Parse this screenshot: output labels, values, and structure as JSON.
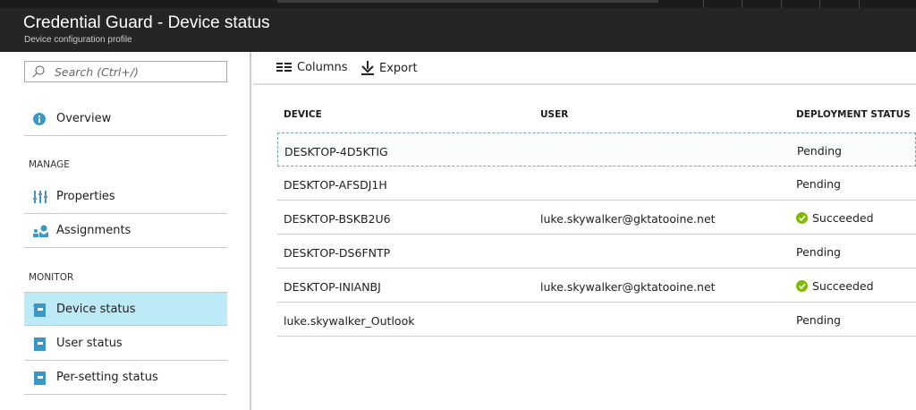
{
  "header": {
    "title": "Credential Guard - Device status",
    "subtitle": "Device configuration profile"
  },
  "sidebar": {
    "search_placeholder": "Search (Ctrl+/)",
    "overview": "Overview",
    "manage_heading": "MANAGE",
    "manage": [
      {
        "label": "Properties",
        "icon": "properties-icon"
      },
      {
        "label": "Assignments",
        "icon": "assignments-icon"
      }
    ],
    "monitor_heading": "MONITOR",
    "monitor": [
      {
        "label": "Device status",
        "selected": true
      },
      {
        "label": "User status"
      },
      {
        "label": "Per-setting status"
      }
    ]
  },
  "toolbar": {
    "columns": "Columns",
    "export": "Export"
  },
  "table": {
    "headers": [
      "DEVICE",
      "USER",
      "DEPLOYMENT STATUS"
    ],
    "rows": [
      {
        "device": "DESKTOP-4D5KTIG",
        "user": "",
        "status": "Pending"
      },
      {
        "device": "DESKTOP-AFSDJ1H",
        "user": "",
        "status": "Pending"
      },
      {
        "device": "DESKTOP-BSKB2U6",
        "user": "luke.skywalker@gktatooine.net",
        "status": "Succeeded"
      },
      {
        "device": "DESKTOP-DS6FNTP",
        "user": "",
        "status": "Pending"
      },
      {
        "device": "DESKTOP-INIANBJ",
        "user": "luke.skywalker@gktatooine.net",
        "status": "Succeeded"
      },
      {
        "device": "luke.skywalker_Outlook",
        "user": "",
        "status": "Pending"
      }
    ]
  },
  "colors": {
    "accent": "#3999c6",
    "selected": "#bdeaf7",
    "success": "#7fba00",
    "header": "#252525"
  }
}
